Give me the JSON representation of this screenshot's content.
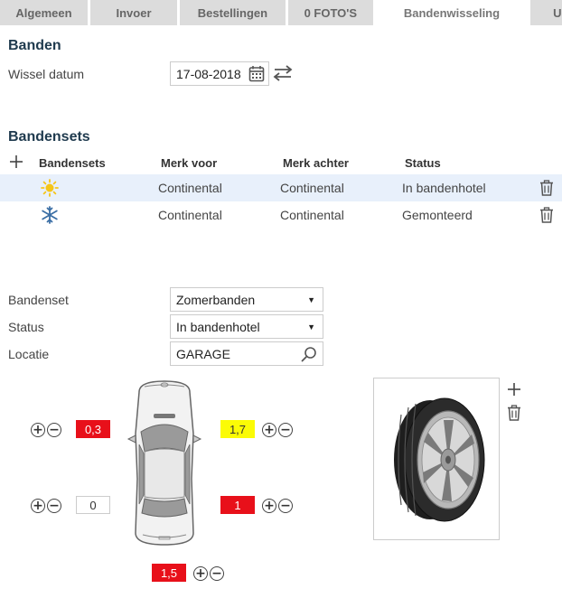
{
  "tabs": [
    {
      "label": "Algemeen"
    },
    {
      "label": "Invoer"
    },
    {
      "label": "Bestellingen"
    },
    {
      "label": "0 FOTO'S"
    },
    {
      "label": "Bandenwisseling"
    },
    {
      "label": "U"
    }
  ],
  "banden": {
    "title": "Banden",
    "wissel_label": "Wissel datum",
    "wissel_value": "17-08-2018"
  },
  "bandensets": {
    "title": "Bandensets",
    "headers": {
      "col1": "Bandensets",
      "col2": "Merk voor",
      "col3": "Merk achter",
      "col4": "Status"
    },
    "rows": [
      {
        "icon": "sun-icon",
        "merk_voor": "Continental",
        "merk_achter": "Continental",
        "status": "In bandenhotel"
      },
      {
        "icon": "snowflake-icon",
        "merk_voor": "Continental",
        "merk_achter": "Continental",
        "status": "Gemonteerd"
      }
    ]
  },
  "form": {
    "bandenset_label": "Bandenset",
    "bandenset_value": "Zomerbanden",
    "status_label": "Status",
    "status_value": "In bandenhotel",
    "locatie_label": "Locatie",
    "locatie_value": "GARAGE"
  },
  "tires": {
    "front_left": "0,3",
    "front_right": "1,7",
    "rear_left": "0",
    "rear_right": "1",
    "spare": "1,5"
  },
  "colors": {
    "red": "#e8101a",
    "yellow": "#fbfb06",
    "selected_row": "#e8f0fb",
    "heading": "#1f3a4e"
  }
}
